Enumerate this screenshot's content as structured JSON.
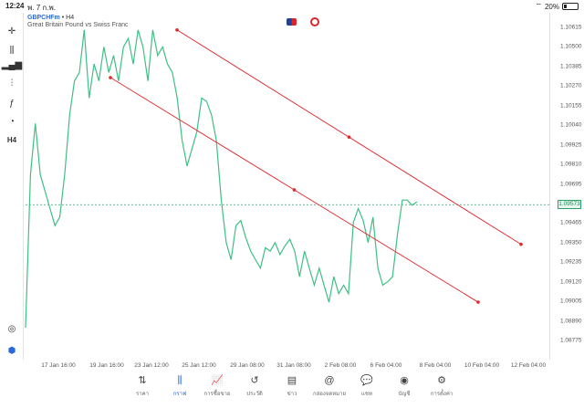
{
  "status": {
    "time": "12:24",
    "date": "พ. 7 ก.พ.",
    "battery": "20%",
    "battery_level": 0.2
  },
  "symbol": {
    "name": "GBPCHFm",
    "timeframe": "H4",
    "description": "Great Britain Pound vs Swiss Franc"
  },
  "toolbar": [
    {
      "name": "crosshair-icon",
      "glyph": "✛"
    },
    {
      "name": "chart-type-icon",
      "glyph": "⫼"
    },
    {
      "name": "bar-chart-icon",
      "glyph": "▂▄▆"
    },
    {
      "name": "indicators-icon",
      "glyph": "⫶"
    },
    {
      "name": "function-icon",
      "glyph": "ƒ"
    },
    {
      "name": "objects-icon",
      "glyph": "◔"
    },
    {
      "name": "timeframe-label",
      "glyph": "H4"
    }
  ],
  "colors": {
    "line": "#3fbf85",
    "trend": "#e0262b",
    "current": "#29a36a",
    "accent": "#2a6ad6"
  },
  "chart_data": {
    "type": "line",
    "series": [
      {
        "values": [
          1.0885,
          1.0975,
          1.1005,
          1.0975,
          1.0965,
          1.0955,
          1.0945,
          1.095,
          1.0975,
          1.101,
          1.103,
          1.1035,
          1.106,
          1.102,
          1.104,
          1.103,
          1.105,
          1.1035,
          1.1045,
          1.103,
          1.105,
          1.1055,
          1.104,
          1.106,
          1.105,
          1.103,
          1.106,
          1.1045,
          1.105,
          1.104,
          1.1035,
          1.102,
          1.0995,
          1.098,
          1.099,
          1.1,
          1.102,
          1.1018,
          1.101,
          1.0995,
          1.096,
          1.0935,
          1.0925,
          1.0945,
          1.0948,
          1.0938,
          1.093,
          1.0925,
          1.092,
          1.0932,
          1.093,
          1.0935,
          1.0928,
          1.0933,
          1.0937,
          1.093,
          1.0915,
          1.093,
          1.092,
          1.091,
          1.092,
          1.091,
          1.09,
          1.0915,
          1.0905,
          1.091,
          1.0905,
          1.0947,
          1.0955,
          1.0948,
          1.0935,
          1.095,
          1.092,
          1.091,
          1.0912,
          1.0915,
          1.094,
          1.096,
          1.096,
          1.0957,
          1.0959
        ]
      }
    ],
    "current_price": "1.09573",
    "y_ticks": [
      "1.10615",
      "1.10500",
      "1.10385",
      "1.10270",
      "1.10155",
      "1.10040",
      "1.09925",
      "1.09810",
      "1.09695",
      "1.09573",
      "1.09465",
      "1.09350",
      "1.09235",
      "1.09120",
      "1.09005",
      "1.08890",
      "1.08775"
    ],
    "x_ticks": [
      "17 Jan 16:00",
      "19 Jan 16:00",
      "23 Jan 12:00",
      "25 Jan 12:00",
      "29 Jan 08:00",
      "31 Jan 08:00",
      "2 Feb 08:00",
      "6 Feb 04:00",
      "8 Feb 04:00",
      "10 Feb 04:00",
      "12 Feb 04:00"
    ],
    "trendlines": [
      {
        "points": [
          [
            1,
            1.106
          ],
          [
            3,
            1.0934
          ]
        ]
      },
      {
        "points": [
          [
            0,
            1.1032
          ],
          [
            2,
            1.09
          ]
        ]
      }
    ]
  },
  "nav": [
    {
      "label": "ราคา",
      "icon": "⇅",
      "active": false
    },
    {
      "label": "กราฟ",
      "icon": "⫼",
      "active": true
    },
    {
      "label": "การซื้อขาย",
      "icon": "📈",
      "active": false
    },
    {
      "label": "ประวัติ",
      "icon": "↺",
      "active": false
    },
    {
      "label": "ข่าว",
      "icon": "▤",
      "active": false
    },
    {
      "label": "กล่องจดหมาย",
      "icon": "@",
      "active": false
    },
    {
      "label": "แชท",
      "icon": "💬",
      "active": false
    },
    {
      "label": "บัญชี",
      "icon": "◉",
      "active": false
    },
    {
      "label": "การตั้งค่า",
      "icon": "⚙",
      "active": false
    }
  ]
}
